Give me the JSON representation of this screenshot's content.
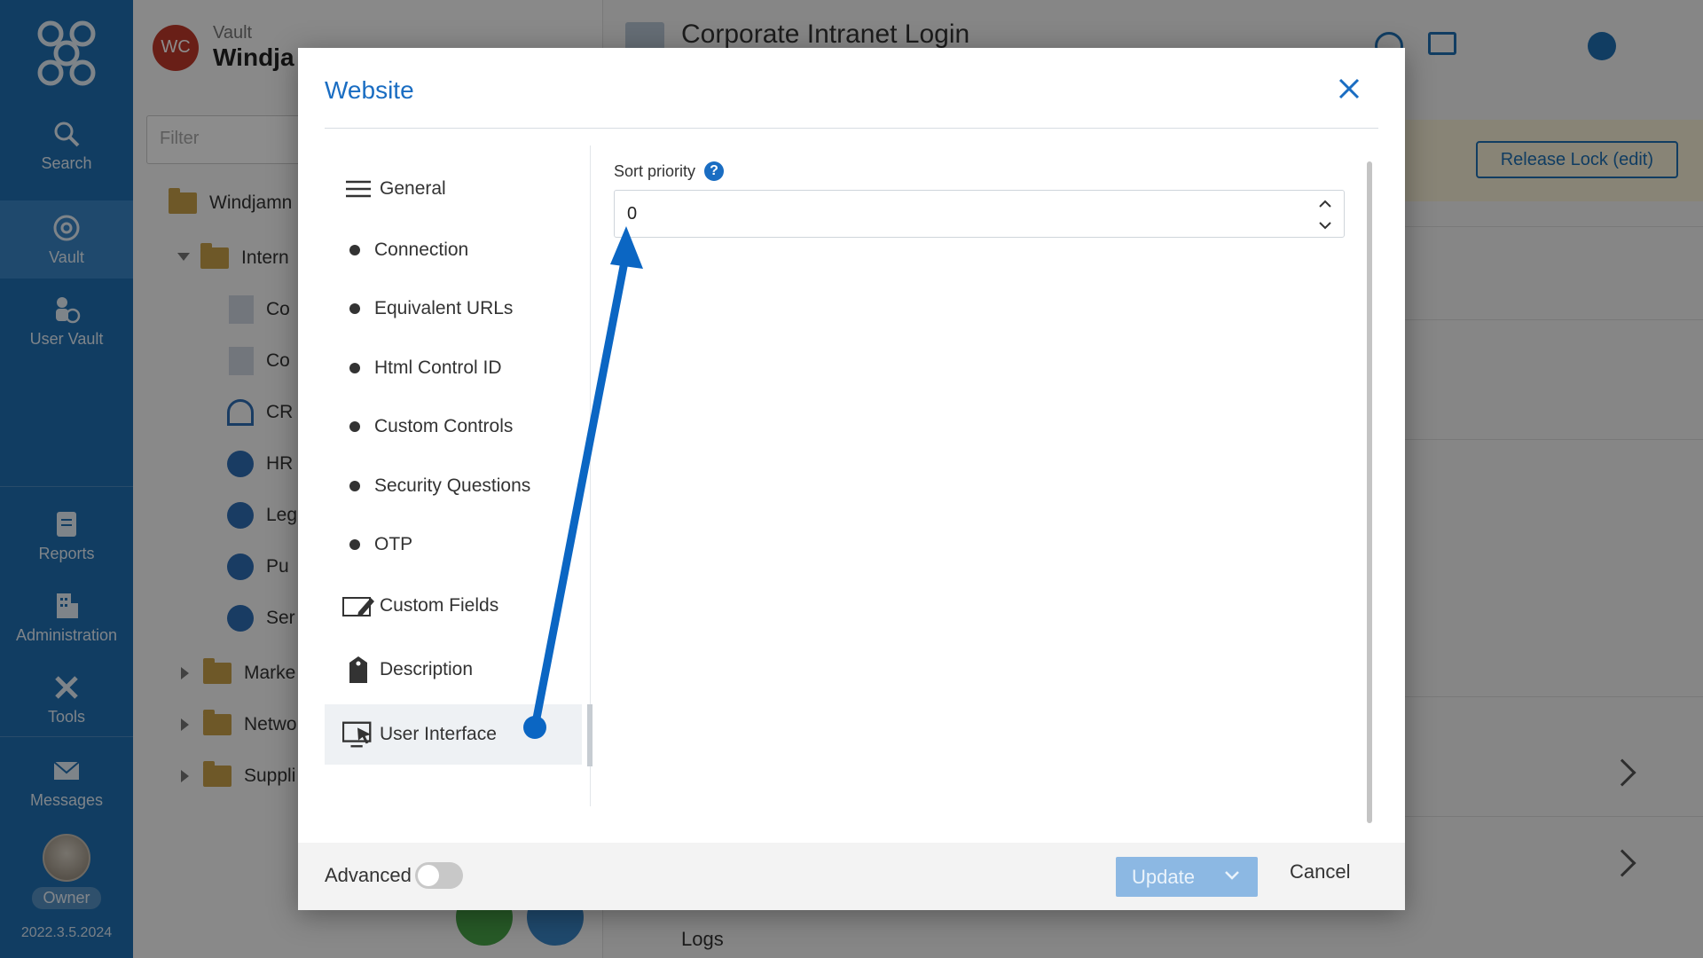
{
  "nav": {
    "items": [
      {
        "label": "Search"
      },
      {
        "label": "Vault"
      },
      {
        "label": "User Vault"
      },
      {
        "label": "Reports"
      },
      {
        "label": "Administration"
      },
      {
        "label": "Tools"
      },
      {
        "label": "Messages"
      }
    ],
    "owner_label": "Owner",
    "version": "2022.3.5.2024"
  },
  "tree": {
    "avatar_initials": "WC",
    "vault_label": "Vault",
    "vault_name": "Windja",
    "filter_placeholder": "Filter",
    "rows": [
      {
        "label": "Windjamn"
      },
      {
        "label": "Intern"
      },
      {
        "label": "Co"
      },
      {
        "label": "Co"
      },
      {
        "label": "CR"
      },
      {
        "label": "HR"
      },
      {
        "label": "Leg"
      },
      {
        "label": "Pu"
      },
      {
        "label": "Ser"
      },
      {
        "label": "Marke"
      },
      {
        "label": "Netwo"
      },
      {
        "label": "Suppli"
      }
    ]
  },
  "content": {
    "entry_title": "Corporate Intranet Login",
    "release_lock_label": "Release Lock (edit)",
    "logs_label": "Logs"
  },
  "dialog": {
    "title": "Website",
    "side_items": [
      {
        "label": "General",
        "icon": "menu-icon"
      },
      {
        "label": "Connection",
        "icon": "bullet"
      },
      {
        "label": "Equivalent URLs",
        "icon": "bullet"
      },
      {
        "label": "Html Control ID",
        "icon": "bullet"
      },
      {
        "label": "Custom Controls",
        "icon": "bullet"
      },
      {
        "label": "Security Questions",
        "icon": "bullet"
      },
      {
        "label": "OTP",
        "icon": "bullet"
      },
      {
        "label": "Custom Fields",
        "icon": "edit-icon"
      },
      {
        "label": "Description",
        "icon": "tag-icon"
      },
      {
        "label": "User Interface",
        "icon": "monitor-cursor-icon",
        "selected": true
      }
    ],
    "sort_priority_label": "Sort priority",
    "help_glyph": "?",
    "sort_priority_value": "0",
    "advanced_label": "Advanced",
    "update_label": "Update",
    "cancel_label": "Cancel"
  },
  "colors": {
    "accent": "#1a6dc2",
    "nav_bg": "#1f6fb2",
    "update_disabled": "#8cb8e3",
    "arrow": "#0b66c3"
  }
}
